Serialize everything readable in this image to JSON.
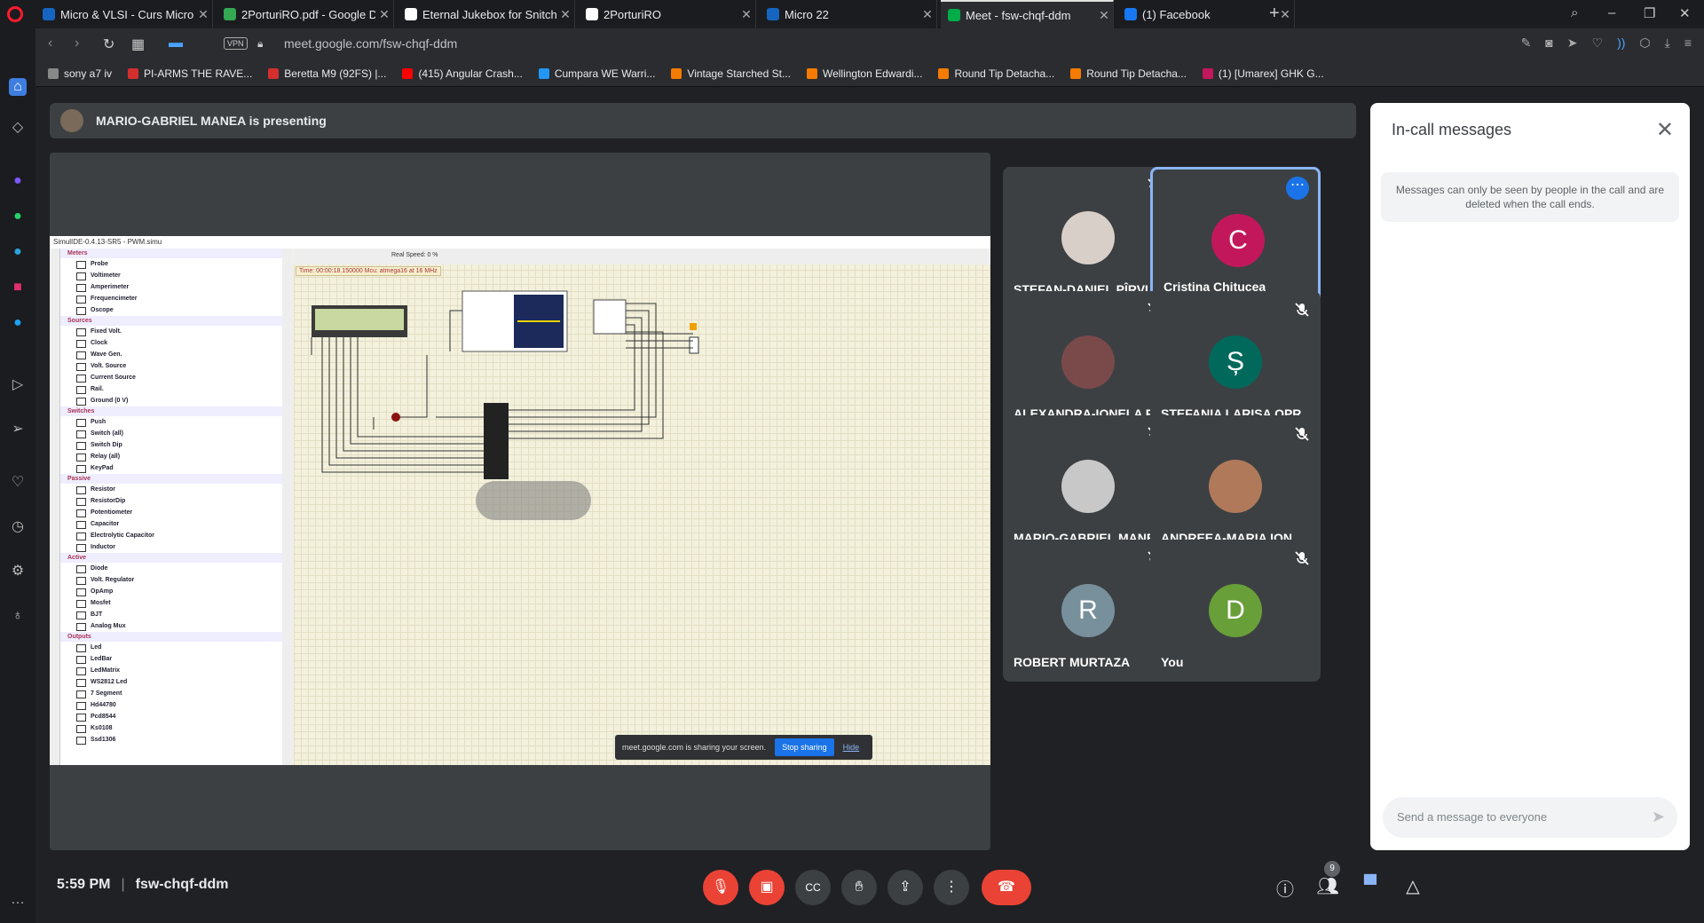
{
  "browser": {
    "tabs": [
      {
        "label": "Micro & VLSI - Curs Micro",
        "color": "#1565c0"
      },
      {
        "label": "2PorturiRO.pdf - Google D",
        "color": "#34a853"
      },
      {
        "label": "Eternal Jukebox for Snitchi",
        "color": "#ffffff"
      },
      {
        "label": "2PorturiRO",
        "color": "#ffffff"
      },
      {
        "label": "Micro 22",
        "color": "#1565c0"
      },
      {
        "label": "Meet - fsw-chqf-ddm",
        "color": "#00ac47"
      },
      {
        "label": "(1) Facebook",
        "color": "#1877f2"
      }
    ],
    "url": "meet.google.com/fsw-chqf-ddm",
    "vpn": "VPN",
    "bookmarks": [
      {
        "label": "sony a7 iv",
        "color": "#888888"
      },
      {
        "label": "PI-ARMS THE RAVE...",
        "color": "#d32f2f"
      },
      {
        "label": "Beretta M9 (92FS) |...",
        "color": "#d32f2f"
      },
      {
        "label": "(415) Angular Crash...",
        "color": "#ff0000"
      },
      {
        "label": "Cumpara WE Warri...",
        "color": "#2196f3"
      },
      {
        "label": "Vintage Starched St...",
        "color": "#f57c00"
      },
      {
        "label": "Wellington Edwardi...",
        "color": "#f57c00"
      },
      {
        "label": "Round Tip Detacha...",
        "color": "#f57c00"
      },
      {
        "label": "Round Tip Detacha...",
        "color": "#f57c00"
      },
      {
        "label": "(1) [Umarex] GHK G...",
        "color": "#c2185b"
      }
    ]
  },
  "meet": {
    "presenting": "MARIO-GABRIEL MANEA is presenting",
    "time": "5:59 PM",
    "code": "fsw-chqf-ddm",
    "participants_count": "9",
    "participants": [
      {
        "name": "ȘTEFAN-DANIEL PÎRVU...",
        "initial": "",
        "color": "#d8d0c8"
      },
      {
        "name": "Cristina Chitucea",
        "initial": "C",
        "color": "#c2185b"
      },
      {
        "name": "ALEXANDRA-IONELA P...",
        "initial": "",
        "color": "#7a4a4a"
      },
      {
        "name": "ȘTEFANIA LARISA OPR...",
        "initial": "Ș",
        "color": "#00695c"
      },
      {
        "name": "MARIO-GABRIEL MANEA",
        "initial": "",
        "color": "#c8c8c8"
      },
      {
        "name": "ANDREEA-MARIA ION",
        "initial": "",
        "color": "#b07a5a"
      },
      {
        "name": "ROBERT MURTAZA",
        "initial": "R",
        "color": "#78909c"
      },
      {
        "name": "You",
        "initial": "D",
        "color": "#689f38"
      }
    ],
    "messages": {
      "title": "In-call messages",
      "notice": "Messages can only be seen by people in the call and are deleted when the call ends.",
      "placeholder": "Send a message to everyone"
    }
  },
  "screen_share": {
    "window_title": "SimulIDE-0.4.13-SR5 - PWM.simu",
    "status": "Time: 00:00:18.150000    Mcu: atmega16 at 16 MHz",
    "real_speed": "Real Speed: 0 %",
    "share_notice": "meet.google.com is sharing your screen.",
    "stop_label": "Stop sharing",
    "hide_label": "Hide",
    "categories": [
      {
        "name": "Meters",
        "items": [
          "Probe",
          "Voltimeter",
          "Amperimeter",
          "Frequencimeter",
          "Oscope"
        ]
      },
      {
        "name": "Sources",
        "items": [
          "Fixed Volt.",
          "Clock",
          "Wave Gen.",
          "Volt. Source",
          "Current Source",
          "Rail.",
          "Ground (0 V)"
        ]
      },
      {
        "name": "Switches",
        "items": [
          "Push",
          "Switch (all)",
          "Switch Dip",
          "Relay (all)",
          "KeyPad"
        ]
      },
      {
        "name": "Passive",
        "items": [
          "Resistor",
          "ResistorDip",
          "Potentiometer",
          "Capacitor",
          "Electrolytic Capacitor",
          "Inductor"
        ]
      },
      {
        "name": "Active",
        "items": [
          "Diode",
          "Volt. Regulator",
          "OpAmp",
          "Mosfet",
          "BJT",
          "Analog Mux"
        ]
      },
      {
        "name": "Outputs",
        "items": [
          "Led",
          "LedBar",
          "LedMatrix",
          "WS2812 Led",
          "7 Segment",
          "Hd44780",
          "Pcd8544",
          "Ks0108",
          "Ssd1306"
        ]
      }
    ]
  }
}
